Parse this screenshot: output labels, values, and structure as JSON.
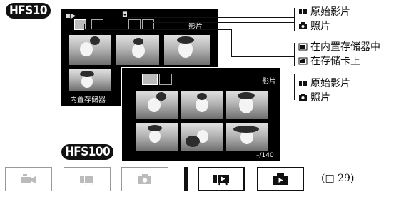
{
  "models": {
    "top": "HFS10",
    "bottom": "HFS100"
  },
  "screens": {
    "back": {
      "title": "影片",
      "location_label": "内置存储器",
      "thumbnail_count": 6
    },
    "front": {
      "title": "影片",
      "counter": "–/140",
      "thumbnail_count": 6
    }
  },
  "legend": {
    "group1": [
      {
        "icon": "movie-icon",
        "text": "原始影片"
      },
      {
        "icon": "camera-icon",
        "text": "照片"
      }
    ],
    "group2": [
      {
        "icon": "built-in-memory-icon",
        "text": "在内置存储器中"
      },
      {
        "icon": "memory-card-icon",
        "text": "在存储卡上"
      }
    ],
    "group3": [
      {
        "icon": "movie-icon",
        "text": "原始影片"
      },
      {
        "icon": "camera-icon",
        "text": "照片"
      }
    ]
  },
  "mode_bar": {
    "buttons": [
      {
        "icon": "camera-shoot-icon",
        "active": false
      },
      {
        "icon": "movie-icon",
        "active": false
      },
      {
        "icon": "photo-camera-icon",
        "active": false
      },
      {
        "icon": "movie-playback-icon",
        "active": true
      },
      {
        "icon": "photo-playback-icon",
        "active": true
      }
    ],
    "page_reference": "(□ 29)"
  },
  "colors": {
    "ink": "#111111",
    "screen": "#000000",
    "inactive_icon": "#bbbbbb"
  }
}
